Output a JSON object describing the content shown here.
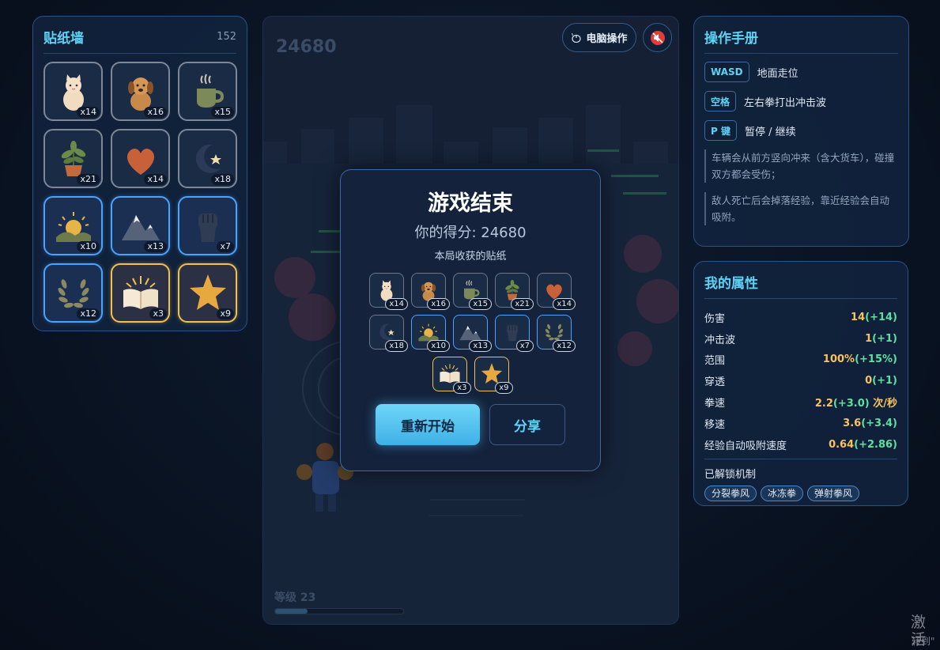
{
  "sticker_wall": {
    "title": "贴纸墙",
    "count": "152",
    "items": [
      {
        "icon": "cat-icon",
        "count": "x14",
        "tier": "common"
      },
      {
        "icon": "puppy-icon",
        "count": "x16",
        "tier": "common"
      },
      {
        "icon": "coffee-cup-icon",
        "count": "x15",
        "tier": "common"
      },
      {
        "icon": "potted-plant-icon",
        "count": "x21",
        "tier": "common"
      },
      {
        "icon": "heart-icon",
        "count": "x14",
        "tier": "common"
      },
      {
        "icon": "moon-star-icon",
        "count": "x18",
        "tier": "common"
      },
      {
        "icon": "sunrise-icon",
        "count": "x10",
        "tier": "rare"
      },
      {
        "icon": "mountain-icon",
        "count": "x13",
        "tier": "rare"
      },
      {
        "icon": "fist-icon",
        "count": "x7",
        "tier": "rare"
      },
      {
        "icon": "laurel-icon",
        "count": "x12",
        "tier": "rare"
      },
      {
        "icon": "open-book-icon",
        "count": "x3",
        "tier": "epic"
      },
      {
        "icon": "star-icon",
        "count": "x9",
        "tier": "epic"
      }
    ]
  },
  "game": {
    "hud_score": "24680",
    "level_label": "等级 23",
    "xp_progress": 0.25,
    "pc_controls_label": "电脑操作",
    "mute_icon": "speaker-muted-icon"
  },
  "modal": {
    "title": "游戏结束",
    "score_label": "你的得分: 24680",
    "stickers_label": "本局收获的贴纸",
    "restart_label": "重新开始",
    "share_label": "分享"
  },
  "manual": {
    "title": "操作手册",
    "keys": [
      {
        "key": "WASD",
        "desc": "地面走位"
      },
      {
        "key": "空格",
        "desc": "左右拳打出冲击波"
      },
      {
        "key": "P 键",
        "desc": "暂停 / 继续"
      }
    ],
    "notes": [
      "车辆会从前方竖向冲来（含大货车），碰撞双方都会受伤；",
      "敌人死亡后会掉落经验，靠近经验会自动吸附。"
    ]
  },
  "stats": {
    "title": "我的属性",
    "rows": [
      {
        "label": "伤害",
        "value": "14",
        "bonus": "(+14)",
        "unit": ""
      },
      {
        "label": "冲击波",
        "value": "1",
        "bonus": "(+1)",
        "unit": ""
      },
      {
        "label": "范围",
        "value": "100%",
        "bonus": "(+15%)",
        "unit": ""
      },
      {
        "label": "穿透",
        "value": "0",
        "bonus": "(+1)",
        "unit": ""
      },
      {
        "label": "拳速",
        "value": "2.2",
        "bonus": "(+3.0)",
        "unit": " 次/秒"
      },
      {
        "label": "移速",
        "value": "3.6",
        "bonus": "(+3.4)",
        "unit": ""
      },
      {
        "label": "经验自动吸附速度",
        "value": "0.64",
        "bonus": "(+2.86)",
        "unit": ""
      }
    ],
    "unlocked_title": "已解锁机制",
    "unlocked": [
      "分裂拳风",
      "冰冻拳",
      "弹射拳风"
    ]
  },
  "watermark": {
    "line1": "激活",
    "line2": "转到\""
  },
  "colors": {
    "accent": "#5fd3f5",
    "gold": "#f7c35f",
    "green": "#5ee0a0",
    "rare": "#4aa3ff",
    "epic": "#f0c050"
  }
}
